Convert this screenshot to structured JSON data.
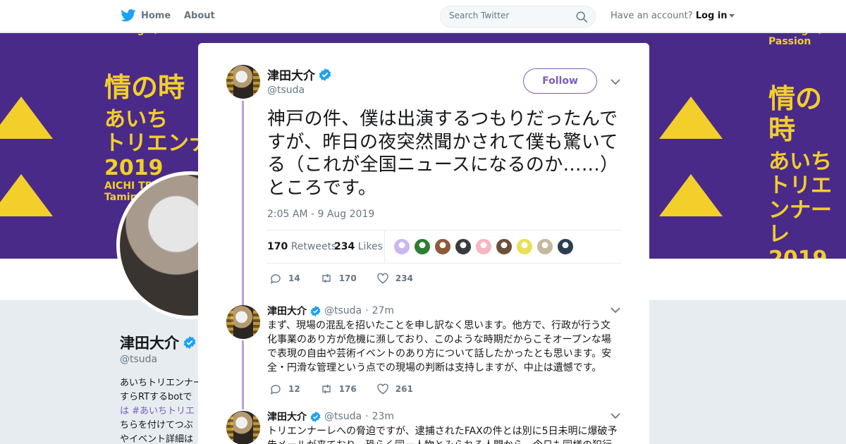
{
  "nav": {
    "home_label": "Home",
    "about_label": "About",
    "search_placeholder": "Search Twitter",
    "account_prompt": "Have an account?",
    "login_label": "Log in"
  },
  "banner": {
    "line1": "Taming Y/Our Passion",
    "line2": "情の時",
    "line3": "あいち",
    "line4": "トリエンナーレ",
    "line5": "2019",
    "line6": "AICHI TRIENNALE",
    "line7": "Taming Y/Our"
  },
  "profile": {
    "name": "津田大介",
    "handle": "@tsuda",
    "bio_lines": [
      "あいちトリエンナーレ",
      "すらRTするbotで",
      "は #あいちトリエ",
      "ちらを付けてつぶ",
      "やイベント詳細は"
    ]
  },
  "tweet": {
    "author_name": "津田大介",
    "author_handle": "@tsuda",
    "follow_label": "Follow",
    "text": "神戸の件、僕は出演するつもりだったんですが、昨日の夜突然聞かされて僕も驚いてる（これが全国ニュースになるのか……）ところです。",
    "timestamp": "2:05 AM - 9 Aug 2019",
    "retweets_count": "170",
    "retweets_label": "Retweets",
    "likes_count": "234",
    "likes_label": "Likes",
    "liker_colors": [
      "#c9b8f0",
      "#2e7d32",
      "#8d5a3b",
      "#3b3b3b",
      "#f4b6c2",
      "#6b4f3a",
      "#e8e05a",
      "#c7b79e",
      "#2c3e50"
    ],
    "replies": "14",
    "retweets": "170",
    "likes": "234"
  },
  "replies": [
    {
      "author_name": "津田大介",
      "author_handle": "@tsuda",
      "time": "27m",
      "text": "まず、現場の混乱を招いたことを申し訳なく思います。他方で、行政が行う文化事業のあり方が危機に瀕しており、このような時期だからこそオープンな場で表現の自由や芸術イベントのあり方について話したかったとも思います。安全・円滑な管理という点での現場の判断は支持しますが、中止は遺憾です。",
      "replies": "12",
      "retweets": "176",
      "likes": "261"
    },
    {
      "author_name": "津田大介",
      "author_handle": "@tsuda",
      "time": "23m",
      "text": "トリエンナーレへの脅迫ですが、逮捕されたFAXの件とは別に5日未明に爆破予告メールが来ており、恐らく同一人物とみられる人間から、今日も同様の犯行"
    }
  ],
  "colors": {
    "accent": "#7c5cbf",
    "thread_line": "#b3a2d8",
    "banner_bg": "#4a2a88",
    "banner_text": "#f2cf2a",
    "verified": "#1da1f2"
  },
  "icons": [
    "twitter-bird-icon",
    "search-icon",
    "close-icon",
    "verified-icon",
    "chevron-down-icon",
    "reply-icon",
    "retweet-icon",
    "heart-icon"
  ]
}
